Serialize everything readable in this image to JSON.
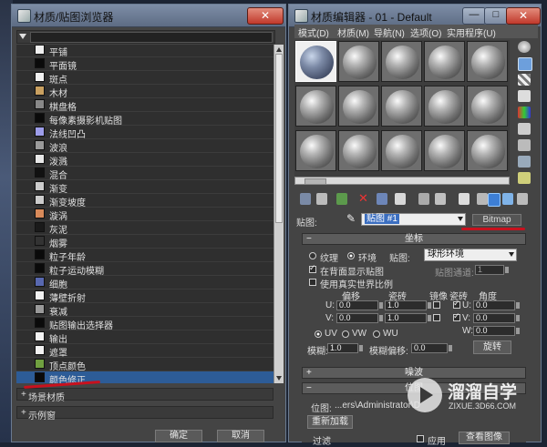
{
  "browser": {
    "title": "材质/贴图浏览器",
    "close_label": "✕",
    "items": [
      {
        "label": "平铺",
        "swatch": "#efefef"
      },
      {
        "label": "平面镜",
        "swatch": "#0a0a0a"
      },
      {
        "label": "斑点",
        "swatch": "#f2f2f2"
      },
      {
        "label": "木材",
        "swatch": "#c9a060"
      },
      {
        "label": "棋盘格",
        "swatch": "#888888"
      },
      {
        "label": "每像素摄影机贴图",
        "swatch": "#0a0a0a"
      },
      {
        "label": "法线凹凸",
        "swatch": "#9d9dea"
      },
      {
        "label": "波浪",
        "swatch": "#9a9a9a"
      },
      {
        "label": "泼溅",
        "swatch": "#e8e8e8"
      },
      {
        "label": "混合",
        "swatch": "#111111"
      },
      {
        "label": "渐变",
        "swatch": "#cccccc"
      },
      {
        "label": "渐变坡度",
        "swatch": "#cccccc"
      },
      {
        "label": "漩涡",
        "swatch": "#d88a5a"
      },
      {
        "label": "灰泥",
        "swatch": "#1a1a1a"
      },
      {
        "label": "烟雾",
        "swatch": "#333333"
      },
      {
        "label": "粒子年龄",
        "swatch": "#0a0a0a"
      },
      {
        "label": "粒子运动模糊",
        "swatch": "#0a0a0a"
      },
      {
        "label": "细胞",
        "swatch": "#5868b0"
      },
      {
        "label": "薄壁折射",
        "swatch": "#f0f0f0"
      },
      {
        "label": "衰减",
        "swatch": "#999999"
      },
      {
        "label": "贴图输出选择器",
        "swatch": "#0a0a0a"
      },
      {
        "label": "输出",
        "swatch": "#f2f2f2"
      },
      {
        "label": "遮罩",
        "swatch": "#f2f2f2"
      },
      {
        "label": "顶点颜色",
        "swatch": "#70a040"
      },
      {
        "label": "颜色修正",
        "swatch": "#0a0a0a"
      }
    ],
    "selected_index": 24,
    "groups": [
      "场景材质",
      "示例窗"
    ],
    "ok_label": "确定",
    "cancel_label": "取消"
  },
  "editor": {
    "title": "材质编辑器 - 01 - Default",
    "menu": [
      "模式(D)",
      "材质(M)",
      "导航(N)",
      "选项(O)",
      "实用程序(U)"
    ],
    "map_label": "贴图:",
    "map_name": "贴图 #1",
    "map_type": "Bitmap",
    "coords": {
      "title": "坐标",
      "texture_label": "纹理",
      "env_label": "环境",
      "mapping_label": "贴图:",
      "mapping_value": "球形环境",
      "show_back_label": "在背面显示贴图",
      "map_channel_label": "贴图通道:",
      "map_channel_value": "1",
      "real_world_label": "使用真实世界比例",
      "offset_label": "偏移",
      "tiling_label": "瓷砖",
      "mirror_label": "镜像",
      "tile_label": "瓷砖",
      "angle_label": "角度",
      "u_label": "U:",
      "v_label": "V:",
      "w_label": "W:",
      "u_offset": "0.0",
      "v_offset": "0.0",
      "u_tiling": "1.0",
      "v_tiling": "1.0",
      "u_angle": "0.0",
      "v_angle": "0.0",
      "w_angle": "0.0",
      "uv_label": "UV",
      "vw_label": "VW",
      "wu_label": "WU",
      "blur_label": "模糊:",
      "blur_value": "1.0",
      "blur_offset_label": "模糊偏移:",
      "blur_offset_value": "0.0",
      "rotate_label": "旋转"
    },
    "noise_title": "噪波",
    "bitmap_params": {
      "title": "位图",
      "path_label": "位图:",
      "path_value": "...ers\\Administrator\\D",
      "reload_label": "重新加载",
      "filter_label": "过滤",
      "apply_label": "应用",
      "view_image_label": "查看图像"
    }
  },
  "watermark": {
    "brand": "溜溜自学",
    "url": "ZIXUE.3D66.COM"
  }
}
